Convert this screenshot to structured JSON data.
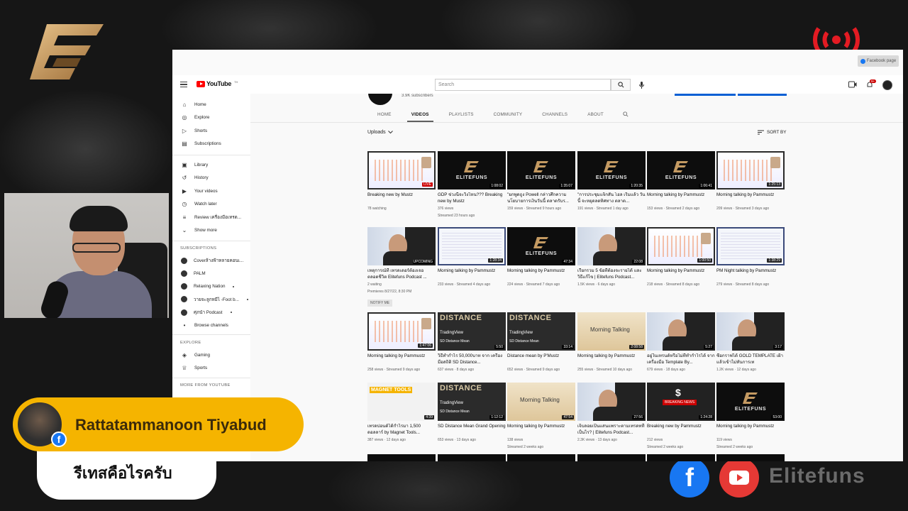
{
  "overlay": {
    "viewer_name": "Rattatammanoon Tiyabud",
    "comment_text": "รีเทสคือไรครับ",
    "brand_text": "Elitefuns",
    "facebook_page_label": "Facebook page"
  },
  "colors": {
    "accent_yellow": "#f5b400",
    "facebook_blue": "#1877f2",
    "youtube_red": "#ff0000"
  },
  "header": {
    "logo_text": "YouTube",
    "logo_country": "TH",
    "search_placeholder": "Search",
    "notification_count": "9+"
  },
  "sidebar": {
    "primary": [
      {
        "label": "Home",
        "icon": "home-icon"
      },
      {
        "label": "Explore",
        "icon": "compass-icon"
      },
      {
        "label": "Shorts",
        "icon": "shorts-icon"
      },
      {
        "label": "Subscriptions",
        "icon": "subscriptions-icon"
      }
    ],
    "library": [
      {
        "label": "Library",
        "icon": "library-icon"
      },
      {
        "label": "History",
        "icon": "history-icon"
      },
      {
        "label": "Your videos",
        "icon": "play-icon"
      },
      {
        "label": "Watch later",
        "icon": "clock-icon"
      },
      {
        "label": "Review เครื่องมือเทรด...",
        "icon": "playlist-icon"
      },
      {
        "label": "Show more",
        "icon": "chevron-down-icon"
      }
    ],
    "subscriptions_heading": "SUBSCRIPTIONS",
    "subscriptions": [
      {
        "label": "Coverล้างฟ้าหลายคอนเ...",
        "live": false
      },
      {
        "label": "PALM",
        "live": false
      },
      {
        "label": "Relaxing Nation",
        "live": true
      },
      {
        "label": "วายจะลูกหมีไ -Foot b...",
        "live": true
      },
      {
        "label": "ศุภนำ Podcast",
        "live": true
      },
      {
        "label": "Browse channels",
        "live": false
      }
    ],
    "explore_heading": "EXPLORE",
    "explore": [
      {
        "label": "Gaming",
        "icon": "gaming-icon"
      },
      {
        "label": "Sports",
        "icon": "trophy-icon"
      }
    ],
    "more_heading": "MORE FROM YOUTUBE"
  },
  "channel": {
    "subscribers": "3.9K subscribers",
    "tabs": [
      "HOME",
      "VIDEOS",
      "PLAYLISTS",
      "COMMUNITY",
      "CHANNELS",
      "ABOUT"
    ],
    "active_tab": "VIDEOS",
    "uploads_label": "Uploads",
    "sort_label": "SORT BY"
  },
  "videos": [
    {
      "title": "Breaking new by Mustz",
      "meta1": "78 watching",
      "meta2": "",
      "badge": "LIVE",
      "kind": "chart"
    },
    {
      "title": "GDP ช่วงนี้จะวิ่งไหน??? Breaking new by Mustz",
      "meta1": "376 views",
      "meta2": "Streamed 23 hours ago",
      "badge": "1:08:02",
      "kind": "logo"
    },
    {
      "title": "\"ยกพูดถูง Powell กล่าวศึกความ นโยบายการเงินวันนี้ ตลาดรับร...",
      "meta1": "159 views · Streamed 9 hours ago",
      "meta2": "",
      "badge": "1:35:07",
      "kind": "logo"
    },
    {
      "title": "\"การประชุมแจ็กสัน โฮล เริ่มแล้ว วันนี้ จะหยุดลดทิศทาง ตลาด...",
      "meta1": "191 views · Streamed 1 day ago",
      "meta2": "",
      "badge": "1:20:35",
      "kind": "logo"
    },
    {
      "title": "Morning talking by Pammustz",
      "meta1": "153 views · Streamed 2 days ago",
      "meta2": "",
      "badge": "1:06:41",
      "kind": "logo"
    },
    {
      "title": "Morning talking by Pammustz",
      "meta1": "209 views · Streamed 3 days ago",
      "meta2": "",
      "badge": "1:25:13",
      "kind": "chart"
    },
    {
      "title": "เหตุการณ์ที่ เทรดเดอร์ต้องเจอ ตลอดชีวิต Elitefuns Podcast ...",
      "meta1": "2 waiting",
      "meta2": "Premieres 8/27/22, 8:30 PM",
      "badge": "UPCOMING",
      "kind": "person",
      "notify": "NOTIFY ME"
    },
    {
      "title": "Morning talking by Pammustz",
      "meta1": "233 views · Streamed 4 days ago",
      "meta2": "",
      "badge": "1:28:34",
      "kind": "table"
    },
    {
      "title": "Morning talking by Pammustz",
      "meta1": "224 views · Streamed 7 days ago",
      "meta2": "",
      "badge": "47:34",
      "kind": "logo"
    },
    {
      "title": "เรียกรวม 5 ข้อที่ต้องจะรายได้ และ วิธีแก้ไข | Elitefuns Podcast...",
      "meta1": "1.5K views · 6 days ago",
      "meta2": "",
      "badge": "22:08",
      "kind": "person"
    },
    {
      "title": "Morning talking by Pammustz",
      "meta1": "218 views · Streamed 8 days ago",
      "meta2": "",
      "badge": "1:00:50",
      "kind": "chart"
    },
    {
      "title": "PM Night talking by Pammustz",
      "meta1": "279 views · Streamed 8 days ago",
      "meta2": "",
      "badge": "1:38:29",
      "kind": "table"
    },
    {
      "title": "Morning talking by Pammustz",
      "meta1": "258 views · Streamed 9 days ago",
      "meta2": "",
      "badge": "1:47:06",
      "kind": "chart"
    },
    {
      "title": "วิธีทำกำไร 50,000บาท จาก เครื่องมือสถิติ SD Distance...",
      "meta1": "637 views · 8 days ago",
      "meta2": "",
      "badge": "5:50",
      "kind": "distance"
    },
    {
      "title": "Distance mean by P'Mustz",
      "meta1": "652 views · Streamed 9 days ago",
      "meta2": "",
      "badge": "33:14",
      "kind": "distance"
    },
    {
      "title": "Morning talking by Pammustz",
      "meta1": "255 views · Streamed 10 days ago",
      "meta2": "",
      "badge": "2:08:58",
      "kind": "morning"
    },
    {
      "title": "อยู่ในเทรนด์หรือไม่ที่ทำกำไรได้ จากเครื่องมือ Template By...",
      "meta1": "679 views · 18 days ago",
      "meta2": "",
      "badge": "5:27",
      "kind": "person"
    },
    {
      "title": "ซื้อกราฟได้ GOLD TEMPLATE เฝ้าแล้วเข้าไม่ทันการเท",
      "meta1": "1.2K views · 12 days ago",
      "meta2": "",
      "badge": "3:17",
      "kind": "person"
    },
    {
      "title": "เทรดปอนด์ได้กำไรมา 1,500 ดอลลาร์ by Magnet Tools...",
      "meta1": "387 views · 12 days ago",
      "meta2": "",
      "badge": "4:39",
      "kind": "magnet"
    },
    {
      "title": "SD Distance Mean Grand Opening",
      "meta1": "653 views · 13 days ago",
      "meta2": "",
      "badge": "1:12:12",
      "kind": "distance"
    },
    {
      "title": "Morning talking by Pammustz",
      "meta1": "138 views",
      "meta2": "Streamed 2 weeks ago",
      "badge": "47:54",
      "kind": "morning"
    },
    {
      "title": "เจ็บลอยเป็นแสนแพราะตามเทรดทที่เป็นไร? | Elitefuns Podcast...",
      "meta1": "2.3K views · 13 days ago",
      "meta2": "",
      "badge": "27:56",
      "kind": "person"
    },
    {
      "title": "Breaking new by Pammustz",
      "meta1": "212 views",
      "meta2": "Streamed 2 weeks ago",
      "badge": "1:24:28",
      "kind": "news"
    },
    {
      "title": "Morning talking by Pammustz",
      "meta1": "119 views",
      "meta2": "Streamed 2 weeks ago",
      "badge": "53:00",
      "kind": "logo"
    }
  ],
  "thumb_text": {
    "logo_name": "ELITEFUNS",
    "distance_title": "DISTANCE",
    "distance_tv": "TradingView",
    "distance_sub": "SD Distance Mean",
    "morning_title": "Morning Talking",
    "news_label": "BREAKING NEWS",
    "magnet_label": "MAGNET TOOLS"
  }
}
